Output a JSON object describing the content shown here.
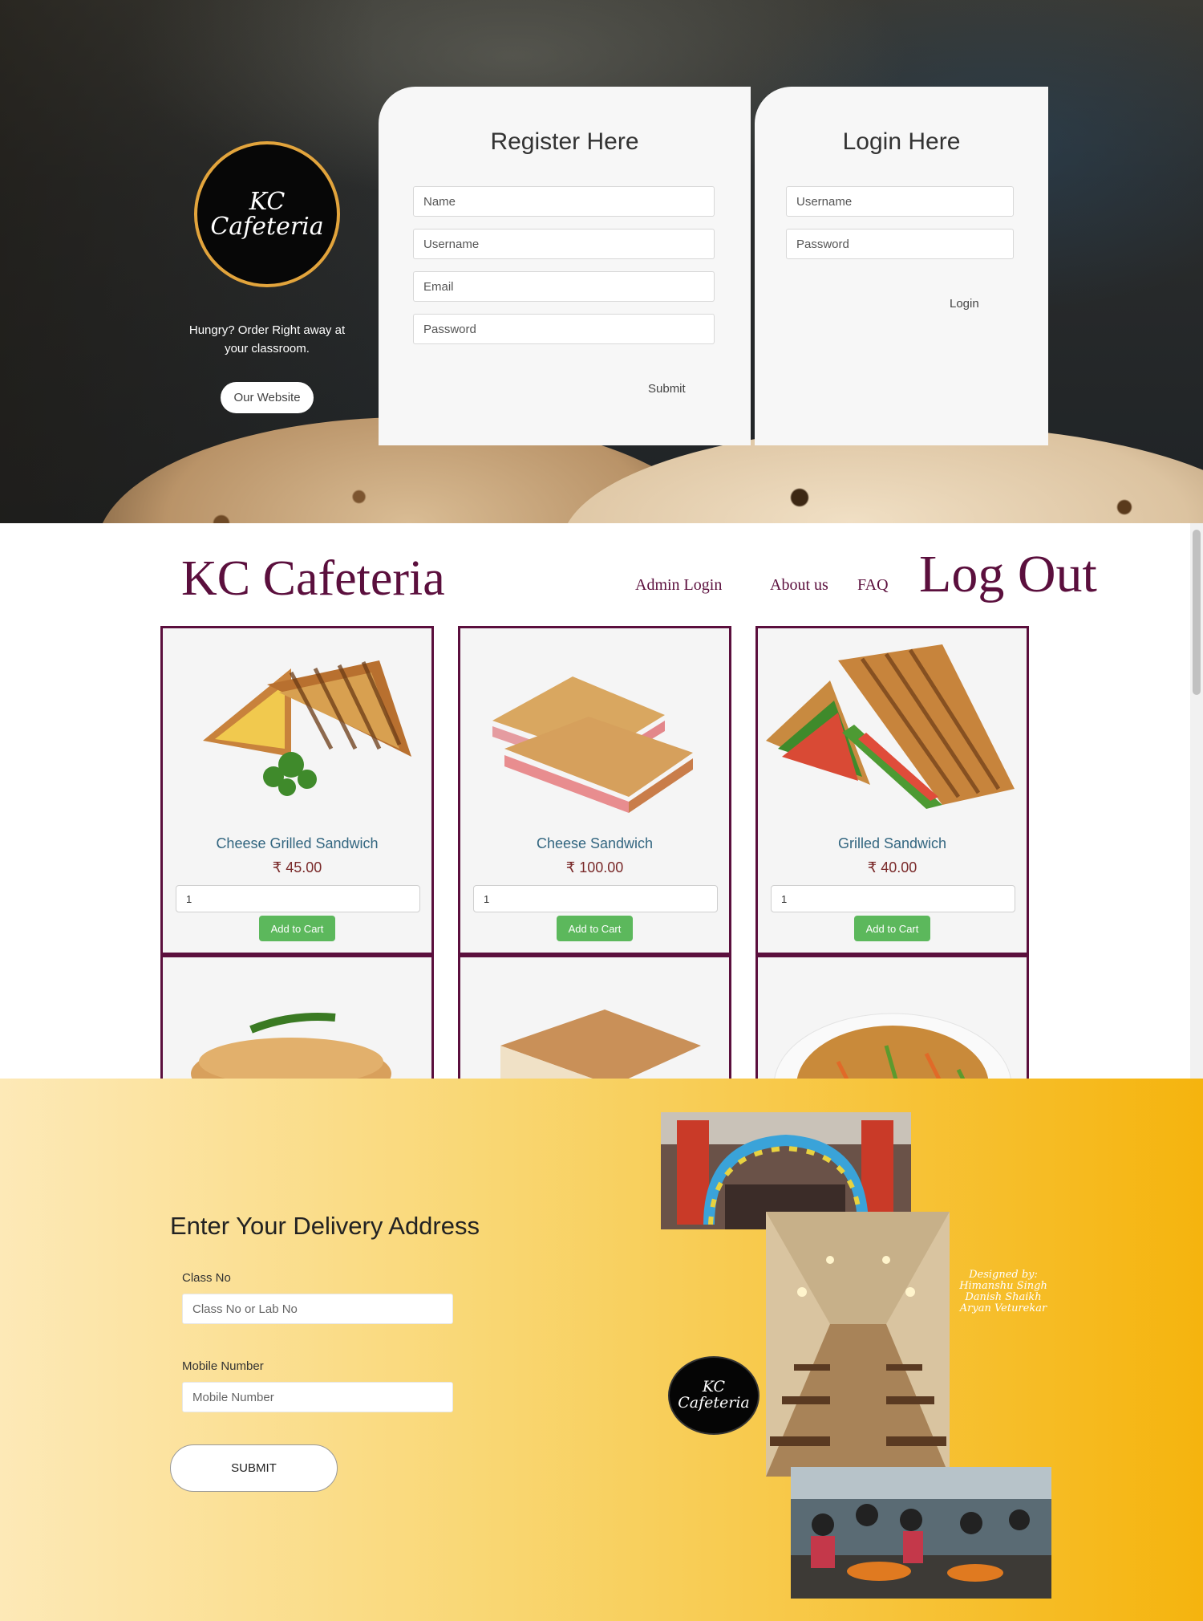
{
  "auth": {
    "brand": {
      "logo_line1": "KC",
      "logo_line2": "Cafeteria",
      "tagline": "Hungry? Order Right away at your classroom.",
      "website_button": "Our Website"
    },
    "register": {
      "title": "Register Here",
      "name_placeholder": "Name",
      "username_placeholder": "Username",
      "email_placeholder": "Email",
      "password_placeholder": "Password",
      "submit_label": "Submit"
    },
    "login": {
      "title": "Login Here",
      "username_placeholder": "Username",
      "password_placeholder": "Password",
      "login_label": "Login"
    }
  },
  "menu": {
    "site_title": "KC Cafeteria",
    "nav": {
      "admin_login": "Admin Login",
      "about_us": "About us",
      "faq": "FAQ",
      "logout": "Log Out"
    },
    "add_to_cart_label": "Add to Cart",
    "products": [
      {
        "name": "Cheese Grilled Sandwich",
        "price": "₹ 45.00",
        "qty": "1"
      },
      {
        "name": "Cheese Sandwich",
        "price": "₹ 100.00",
        "qty": "1"
      },
      {
        "name": "Grilled Sandwich",
        "price": "₹ 40.00",
        "qty": "1"
      }
    ]
  },
  "delivery": {
    "heading": "Enter Your Delivery Address",
    "class_label": "Class No",
    "class_placeholder": "Class No or Lab No",
    "mobile_label": "Mobile Number",
    "mobile_placeholder": "Mobile Number",
    "submit_label": "SUBMIT",
    "credits": {
      "line1": "Designed by:",
      "line2": "Himanshu Singh",
      "line3": "Danish Shaikh",
      "line4": "Aryan Veturekar"
    },
    "logo_line1": "KC",
    "logo_line2": "Cafeteria"
  },
  "colors": {
    "brand_maroon": "#5b0f3d",
    "cart_green": "#5cb85c",
    "logo_gold": "#e2a43c",
    "delivery_yellow": "#f5b40e"
  }
}
